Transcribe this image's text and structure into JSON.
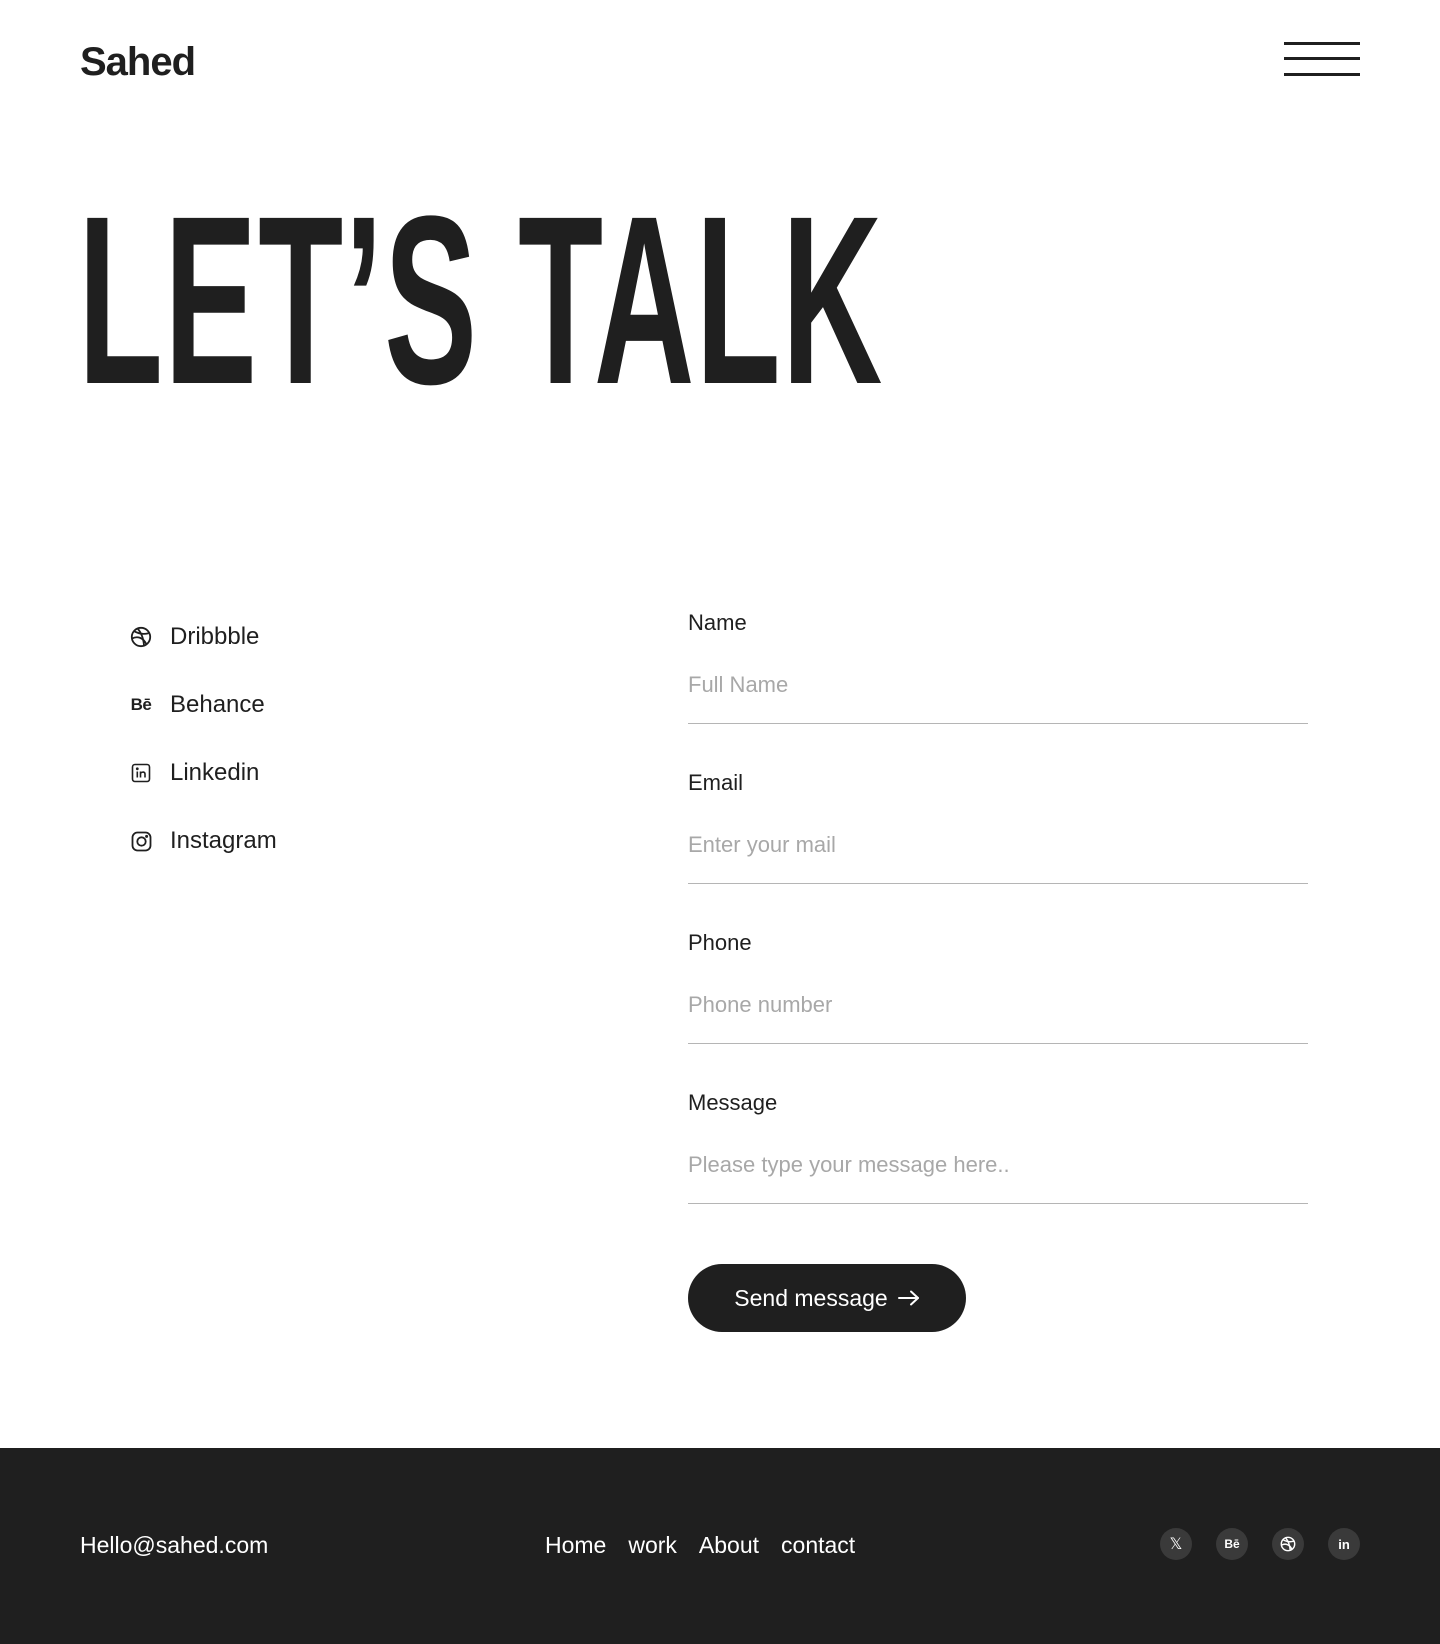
{
  "header": {
    "logo": "Sahed",
    "menu_icon": "hamburger-menu-icon"
  },
  "hero": {
    "title": "LET’S TALK"
  },
  "socials": [
    {
      "label": "Dribbble",
      "icon": "dribbble-icon"
    },
    {
      "label": "Behance",
      "icon": "behance-icon",
      "glyph": "Bē"
    },
    {
      "label": "Linkedin",
      "icon": "linkedin-icon"
    },
    {
      "label": "Instagram",
      "icon": "instagram-icon"
    }
  ],
  "form": {
    "fields": [
      {
        "label": "Name",
        "placeholder": "Full Name",
        "value": ""
      },
      {
        "label": "Email",
        "placeholder": "Enter your mail",
        "value": ""
      },
      {
        "label": "Phone",
        "placeholder": "Phone number",
        "value": ""
      },
      {
        "label": "Message",
        "placeholder": "Please type your message here..",
        "value": ""
      }
    ],
    "submit_label": "Send message",
    "submit_icon": "arrow-right-icon"
  },
  "footer": {
    "email": "Hello@sahed.com",
    "nav": [
      "Home",
      "work",
      "About",
      "contact"
    ],
    "icons": [
      {
        "name": "x-twitter-icon",
        "glyph": "𝕏"
      },
      {
        "name": "behance-icon",
        "glyph": "Bē"
      },
      {
        "name": "dribbble-icon"
      },
      {
        "name": "linkedin-icon",
        "glyph": "in"
      }
    ]
  },
  "colors": {
    "primary": "#1f1f1f",
    "background": "#ffffff",
    "placeholder": "#a8a8a8",
    "divider": "#b5b5b5",
    "footer_icon_bg": "#3a3a3a"
  }
}
